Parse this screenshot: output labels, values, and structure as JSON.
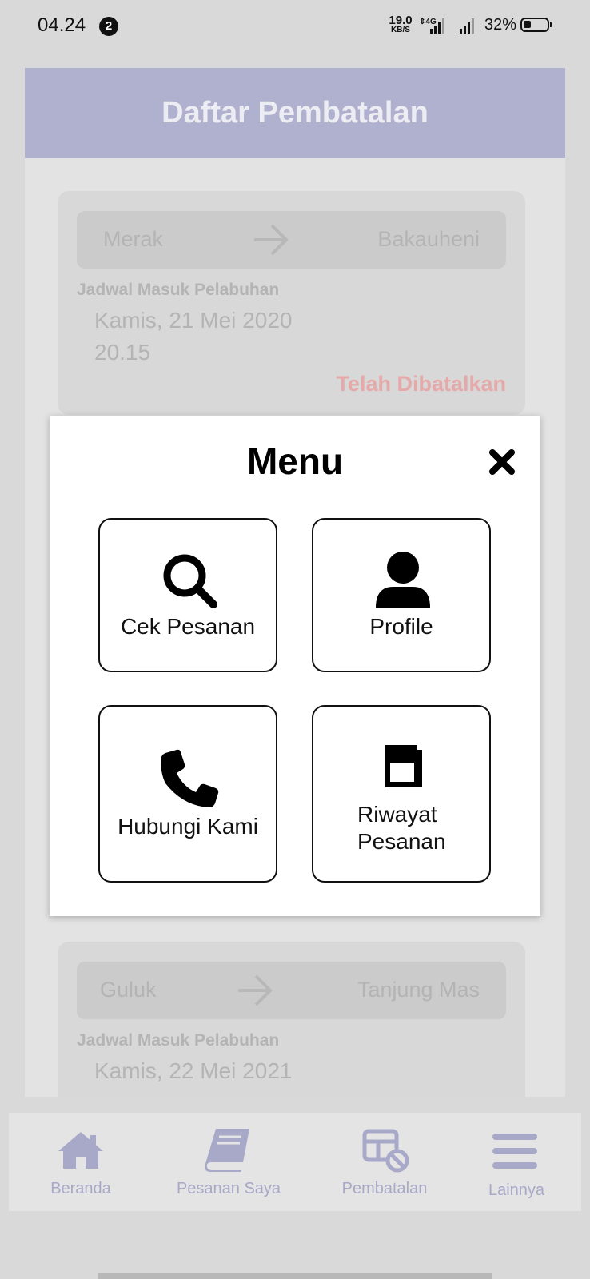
{
  "status_bar": {
    "time": "04.24",
    "notification_count": "2",
    "net_speed_value": "19.0",
    "net_speed_unit": "KB/S",
    "network_type": "4G",
    "battery_percent": "32%"
  },
  "header": {
    "title": "Daftar Pembatalan"
  },
  "cards": [
    {
      "from": "Merak",
      "to": "Bakauheni",
      "schedule_label": "Jadwal Masuk Pelabuhan",
      "date": "Kamis, 21 Mei 2020",
      "time": "20.15",
      "status": "Telah Dibatalkan"
    },
    {
      "from": "Guluk",
      "to": "Tanjung Mas",
      "schedule_label": "Jadwal Masuk Pelabuhan",
      "date": "Kamis, 22 Mei 2021"
    }
  ],
  "menu": {
    "title": "Menu",
    "items": [
      {
        "label": "Cek Pesanan",
        "icon": "search-icon"
      },
      {
        "label": "Profile",
        "icon": "user-icon"
      },
      {
        "label": "Hubungi Kami",
        "icon": "phone-icon"
      },
      {
        "label_line1": "Riwayat",
        "label_line2": "Pesanan",
        "icon": "book-icon"
      }
    ]
  },
  "bottom_nav": {
    "items": [
      {
        "label": "Beranda",
        "icon": "home-icon"
      },
      {
        "label": "Pesanan Saya",
        "icon": "book-icon"
      },
      {
        "label": "Pembatalan",
        "icon": "cancel-table-icon"
      },
      {
        "label": "Lainnya",
        "icon": "menu-icon"
      }
    ]
  },
  "colors": {
    "header_bg": "#b0b0cf",
    "nav_icon": "#a8a8c8",
    "cancel_status": "#e6a9a9",
    "overlay_bg": "#d9d9d9"
  }
}
